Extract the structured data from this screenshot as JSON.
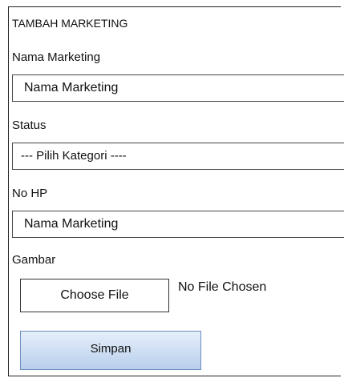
{
  "form": {
    "title": "TAMBAH MARKETING",
    "nama_marketing": {
      "label": "Nama Marketing",
      "value": "Nama  Marketing"
    },
    "status": {
      "label": "Status",
      "selected": "--- Pilih Kategori ----"
    },
    "no_hp": {
      "label": "No HP",
      "value": "Nama  Marketing"
    },
    "gambar": {
      "label": "Gambar",
      "button_label": "Choose File",
      "status_text": "No File Chosen"
    },
    "save_label": "Simpan"
  }
}
